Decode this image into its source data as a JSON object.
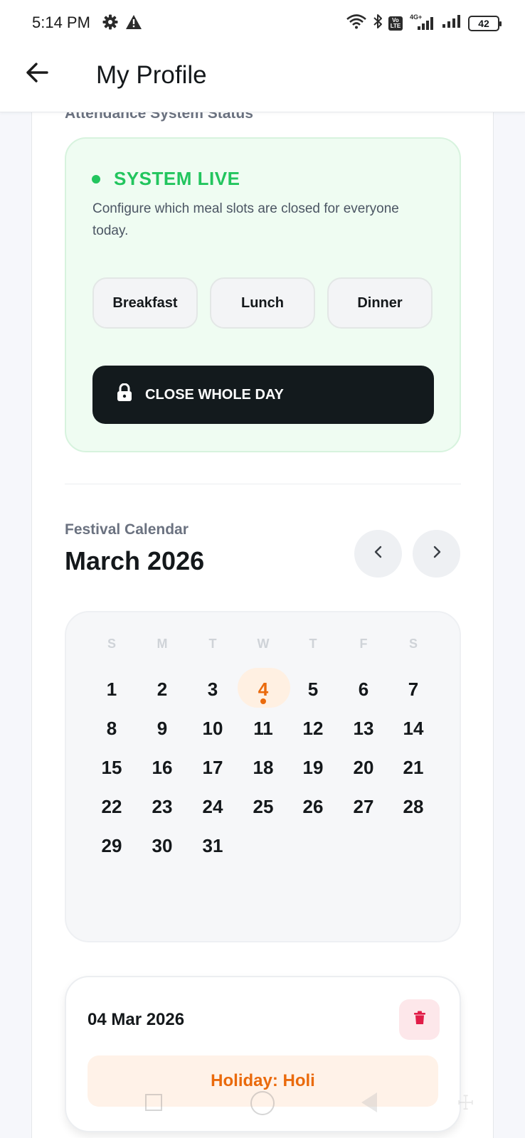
{
  "status_bar": {
    "time": "5:14 PM",
    "battery": "42",
    "icons": [
      "gear-icon",
      "warning-icon",
      "wifi-icon",
      "bluetooth-icon",
      "volte-icon",
      "signal-4g-icon",
      "signal-icon",
      "battery-icon"
    ],
    "volte_top": "Vo",
    "volte_bottom": "LTE",
    "net_label": "4G+"
  },
  "header": {
    "title": "My Profile",
    "back_icon": "arrow-left-icon"
  },
  "attendance": {
    "section_label": "Attendance System Status",
    "status": "SYSTEM LIVE",
    "status_color": "#22c55e",
    "description": "Configure which meal slots are closed for everyone today.",
    "slots": [
      "Breakfast",
      "Lunch",
      "Dinner"
    ],
    "close_day_label": "CLOSE WHOLE DAY",
    "close_day_icon": "lock-icon"
  },
  "calendar": {
    "label": "Festival Calendar",
    "month": "March 2026",
    "weekdays": [
      "S",
      "M",
      "T",
      "W",
      "T",
      "F",
      "S"
    ],
    "days": [
      "1",
      "2",
      "3",
      "4",
      "5",
      "6",
      "7",
      "8",
      "9",
      "10",
      "11",
      "12",
      "13",
      "14",
      "15",
      "16",
      "17",
      "18",
      "19",
      "20",
      "21",
      "22",
      "23",
      "24",
      "25",
      "26",
      "27",
      "28",
      "29",
      "30",
      "31"
    ],
    "selected_day": "4",
    "accent_color": "#ea6a0c"
  },
  "holiday": {
    "date": "04 Mar 2026",
    "label": "Holiday: Holi",
    "delete_icon": "trash-icon"
  }
}
